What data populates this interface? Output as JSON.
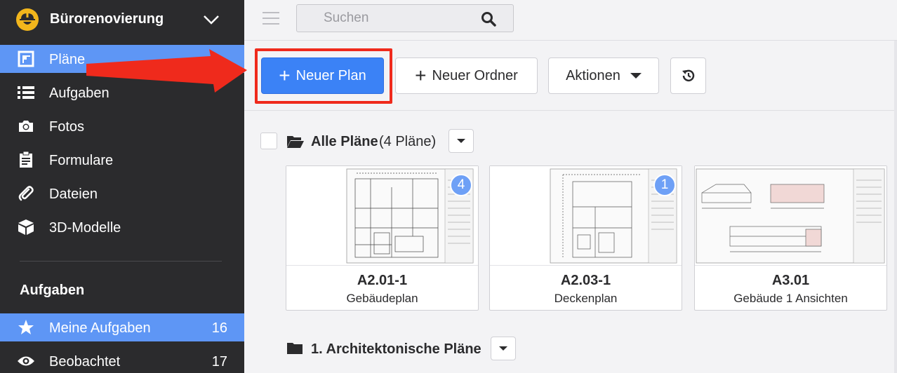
{
  "project": {
    "name": "Bürorenovierung",
    "logo_icon": "hardhat-worker-icon",
    "chevron_icon": "chevron-down-icon"
  },
  "nav": [
    {
      "label": "Pläne",
      "icon": "plans-icon",
      "active": true
    },
    {
      "label": "Aufgaben",
      "icon": "list-icon",
      "active": false
    },
    {
      "label": "Fotos",
      "icon": "camera-icon",
      "active": false
    },
    {
      "label": "Formulare",
      "icon": "clipboard-icon",
      "active": false
    },
    {
      "label": "Dateien",
      "icon": "paperclip-icon",
      "active": false
    },
    {
      "label": "3D-Modelle",
      "icon": "cube-icon",
      "active": false
    }
  ],
  "tasks_section": {
    "heading": "Aufgaben",
    "items": [
      {
        "label": "Meine Aufgaben",
        "count": "16",
        "icon": "star-icon",
        "active": true
      },
      {
        "label": "Beobachtet",
        "count": "17",
        "icon": "eye-icon",
        "active": false
      }
    ]
  },
  "search": {
    "placeholder": "Suchen",
    "icon": "search-icon"
  },
  "toolbar": {
    "new_plan_label": "Neuer Plan",
    "new_folder_label": "Neuer Ordner",
    "actions_label": "Aktionen",
    "history_icon": "history-icon"
  },
  "folder": {
    "title": "Alle Pläne",
    "count_text": "(4 Pläne)"
  },
  "plans": [
    {
      "code": "A2.01-1",
      "name": "Gebäudeplan",
      "badge": "4"
    },
    {
      "code": "A2.03-1",
      "name": "Deckenplan",
      "badge": "1"
    },
    {
      "code": "A3.01",
      "name": "Gebäude 1 Ansichten",
      "badge": ""
    }
  ],
  "subfolder": {
    "title": "1. Architektonische Pläne"
  },
  "colors": {
    "sidebar": "#2b2b2d",
    "accent": "#5e96f5",
    "primary_button": "#3b82f6",
    "highlight": "#ef2a1c",
    "badge": "#6ea0f6"
  }
}
